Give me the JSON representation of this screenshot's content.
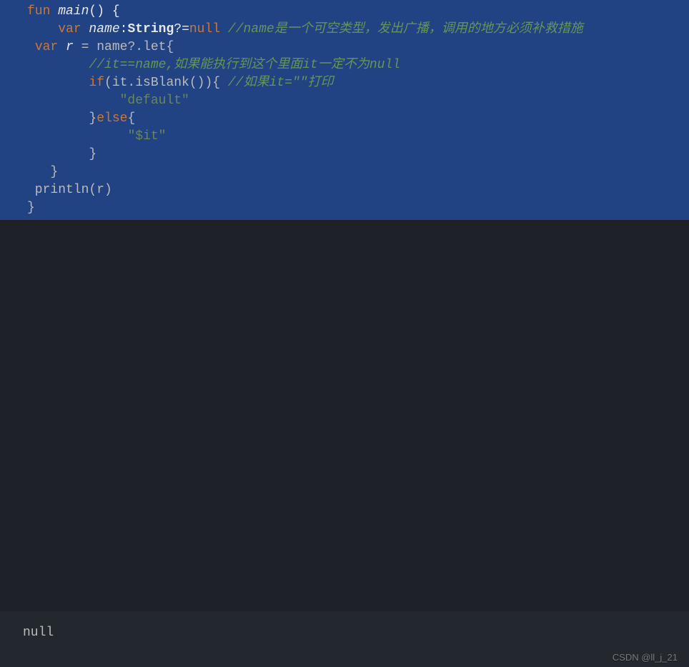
{
  "code": {
    "l1_fun": "fun",
    "l1_main": " main",
    "l1_rest": "() {",
    "l2_indent": "    ",
    "l2_var": "var",
    "l2_name": " name",
    "l2_colon": ":",
    "l2_type": "String",
    "l2_qeq": "?=",
    "l2_null": "null",
    "l2_sp": " ",
    "l2_comment": "//name是一个可空类型，发出广播，调用的地方必须补救措施",
    "l3_indent": " ",
    "l3_var": "var",
    "l3_r": " r",
    "l3_eq": " = name?.let{",
    "l4_indent": "        ",
    "l4_comment": "//it==name,如果能执行到这个里面it一定不为null",
    "l5_indent": "        ",
    "l5_if": "if",
    "l5_cond": "(it.isBlank()){ ",
    "l5_comment": "//如果it=\"\"打印",
    "l6_indent": "            ",
    "l6_str": "\"default\"",
    "l7_indent": "        }",
    "l7_else": "else",
    "l7_brace": "{",
    "l8_indent": "             ",
    "l8_str": "\"$it\"",
    "l9_indent": "        }",
    "l10_indent": "   }",
    "l11_indent": " println(r)",
    "l12": "}"
  },
  "console": {
    "output": "null"
  },
  "watermark": "CSDN @ll_j_21"
}
